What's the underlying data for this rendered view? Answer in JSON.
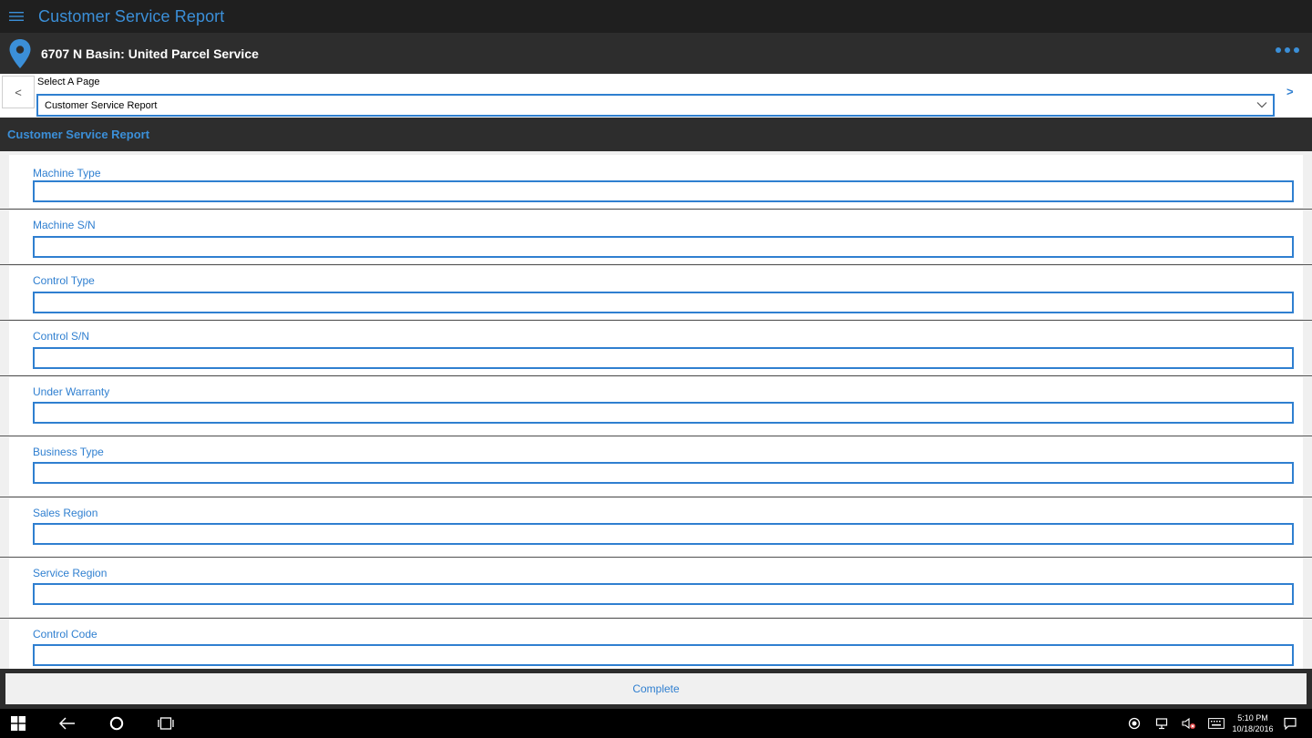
{
  "app": {
    "title": "Customer Service Report",
    "menu_icon": "hamburger-icon"
  },
  "location": {
    "text": "6707 N Basin: United Parcel Service",
    "icon": "map-pin-icon",
    "accent": "#3b8fd8"
  },
  "page_selector": {
    "label": "Select A Page",
    "selected": "Customer Service Report",
    "prev_label": "<",
    "next_label": ">"
  },
  "section": {
    "title": "Customer Service Report"
  },
  "fields": [
    {
      "label": "Machine Type",
      "value": ""
    },
    {
      "label": "Machine S/N",
      "value": ""
    },
    {
      "label": "Control Type",
      "value": ""
    },
    {
      "label": "Control S/N",
      "value": ""
    },
    {
      "label": "Under Warranty",
      "value": ""
    },
    {
      "label": "Business Type",
      "value": ""
    },
    {
      "label": "Sales Region",
      "value": ""
    },
    {
      "label": "Service Region",
      "value": ""
    },
    {
      "label": "Control Code",
      "value": ""
    }
  ],
  "actions": {
    "complete_label": "Complete"
  },
  "taskbar": {
    "time": "5:10 PM",
    "date": "10/18/2016"
  },
  "colors": {
    "accent": "#2f7fd0",
    "title_bar": "#1f1f1f",
    "header_bar": "#2d2d2d"
  }
}
